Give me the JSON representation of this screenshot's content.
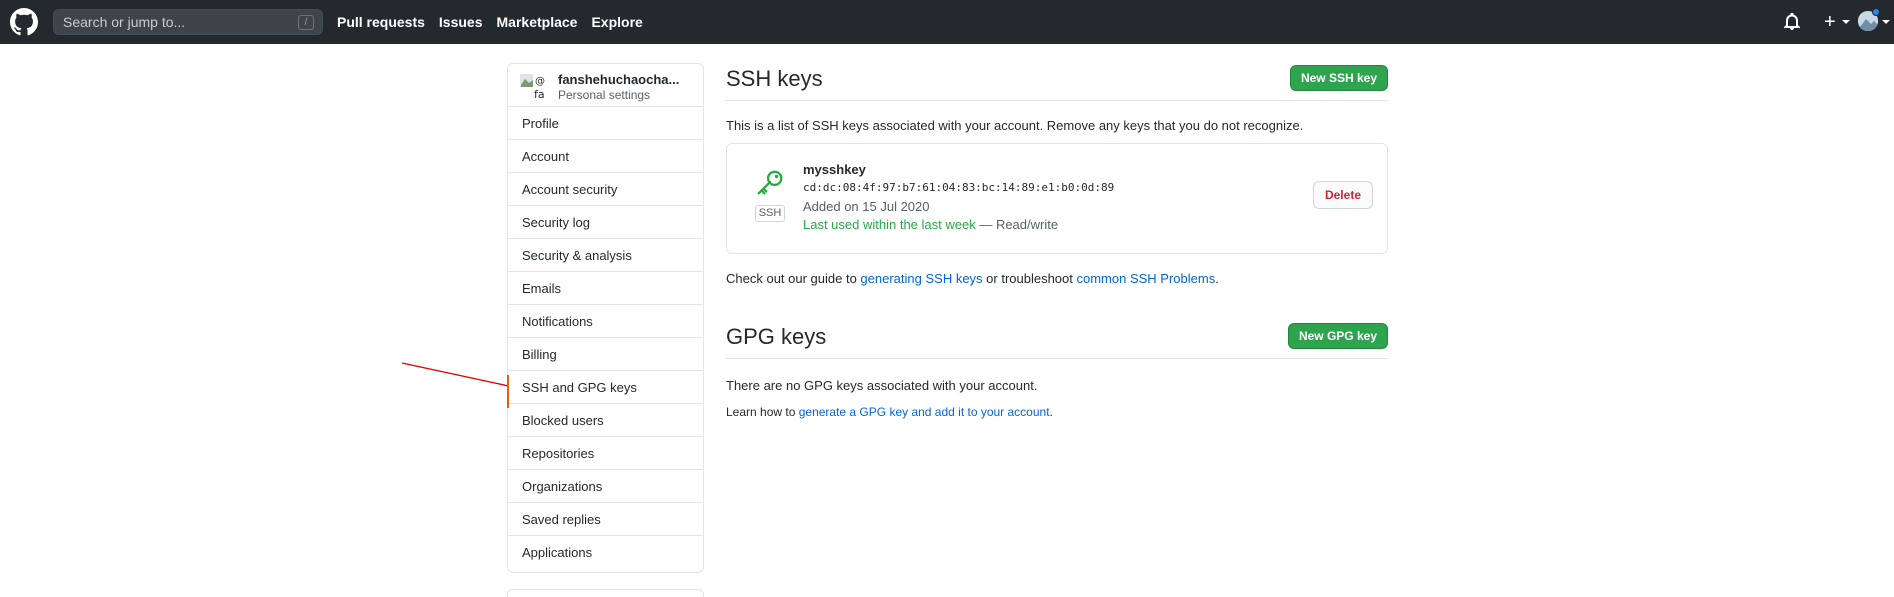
{
  "header": {
    "search_placeholder": "Search or jump to...",
    "search_shortcut": "/",
    "nav": [
      "Pull requests",
      "Issues",
      "Marketplace",
      "Explore"
    ],
    "icons": [
      "github-logo",
      "bell-icon",
      "plus-icon",
      "avatar"
    ]
  },
  "sidebar": {
    "username": "fanshehuchaocha...",
    "subtitle": "Personal settings",
    "avatar_alt": "@fa",
    "items": [
      {
        "label": "Profile"
      },
      {
        "label": "Account"
      },
      {
        "label": "Account security"
      },
      {
        "label": "Security log"
      },
      {
        "label": "Security & analysis"
      },
      {
        "label": "Emails"
      },
      {
        "label": "Notifications"
      },
      {
        "label": "Billing"
      },
      {
        "label": "SSH and GPG keys",
        "active": true
      },
      {
        "label": "Blocked users"
      },
      {
        "label": "Repositories"
      },
      {
        "label": "Organizations"
      },
      {
        "label": "Saved replies"
      },
      {
        "label": "Applications"
      }
    ]
  },
  "ssh": {
    "title": "SSH keys",
    "new_button": "New SSH key",
    "description": "This is a list of SSH keys associated with your account. Remove any keys that you do not recognize.",
    "key": {
      "name": "mysshkey",
      "fingerprint": "cd:dc:08:4f:97:b7:61:04:83:bc:14:89:e1:b0:0d:89",
      "added": "Added on 15 Jul 2020",
      "last_used": "Last used within the last week",
      "access": " — Read/write",
      "badge": "SSH",
      "delete_button": "Delete"
    },
    "guide_prefix": "Check out our guide to ",
    "guide_link1": "generating SSH keys",
    "guide_mid": " or troubleshoot ",
    "guide_link2": "common SSH Problems",
    "guide_suffix": "."
  },
  "gpg": {
    "title": "GPG keys",
    "new_button": "New GPG key",
    "empty": "There are no GPG keys associated with your account.",
    "learn_prefix": "Learn how to ",
    "learn_link": "generate a GPG key and add it to your account",
    "learn_suffix": "."
  },
  "colors": {
    "header_bg": "#24292e",
    "green": "#2ea44f",
    "link": "#0366d6",
    "danger": "#cb2431",
    "annotation": "#e00000"
  }
}
